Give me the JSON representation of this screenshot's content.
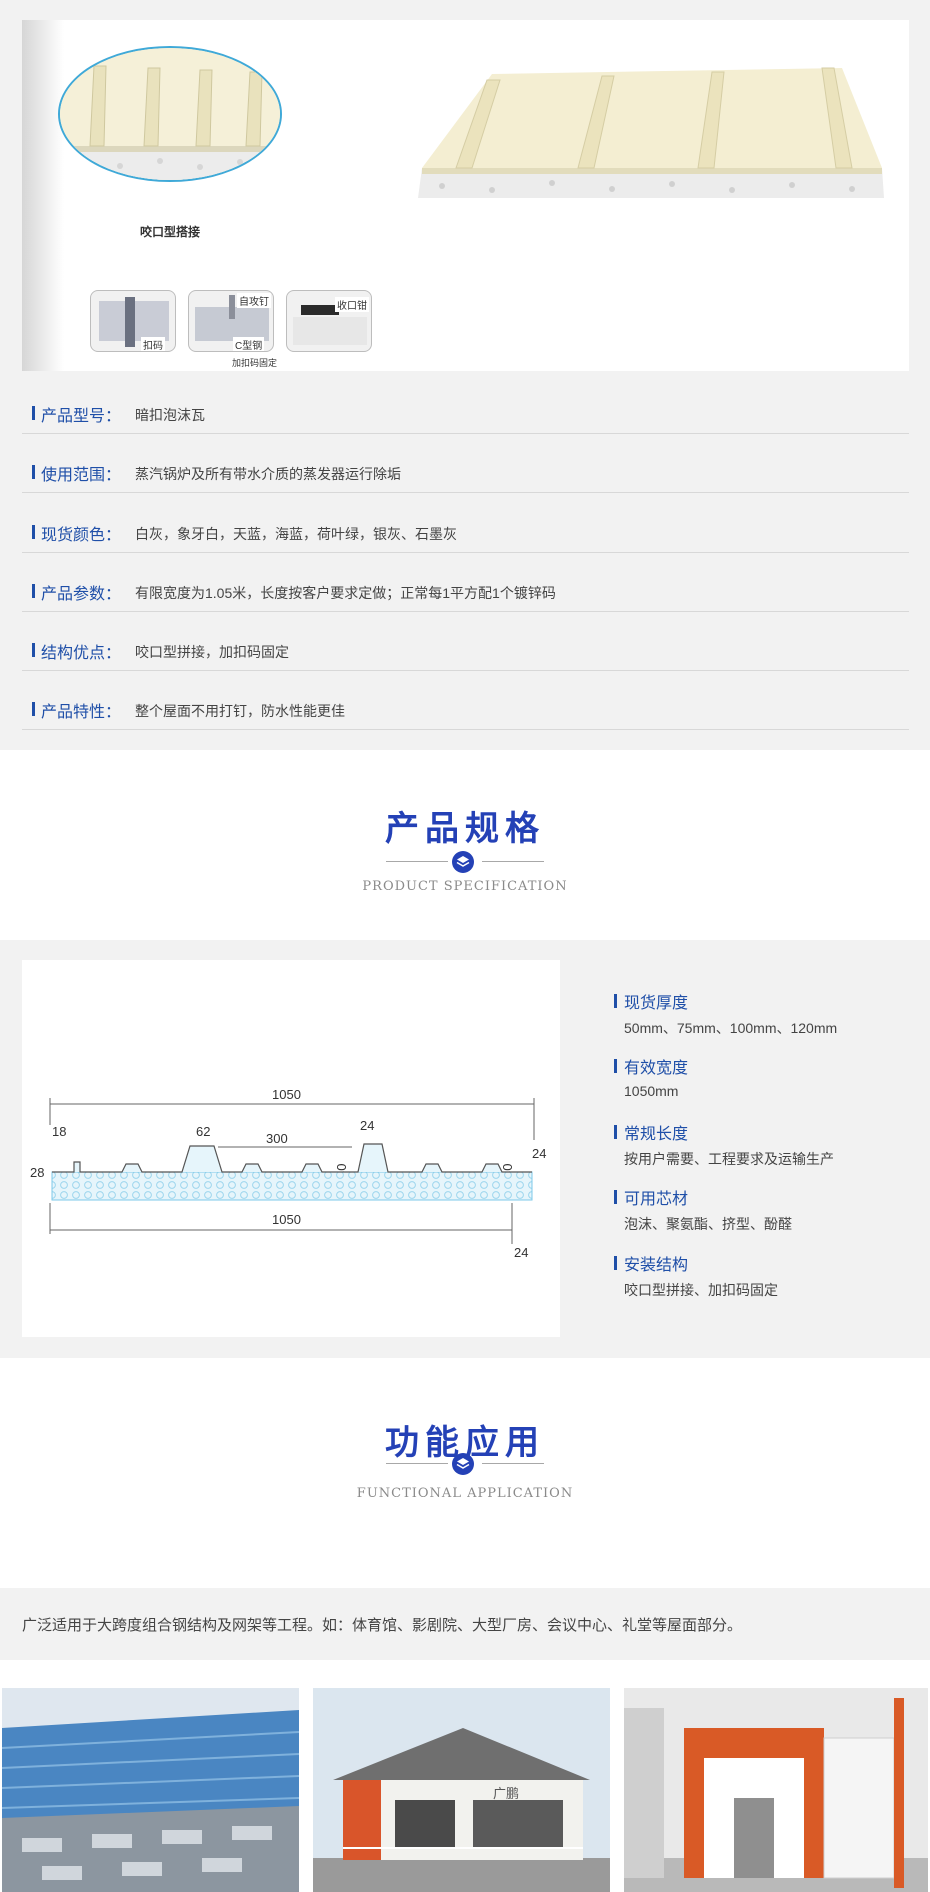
{
  "product": {
    "image": {
      "oval_caption": "咬口型搭接",
      "thumbs": [
        "扣码",
        "自攻钉",
        "C型钢",
        "收口钳"
      ],
      "thumb_sub": "加扣码固定"
    },
    "properties": [
      {
        "label": "产品型号：",
        "value": "暗扣泡沫瓦"
      },
      {
        "label": "使用范围：",
        "value": "蒸汽锅炉及所有带水介质的蒸发器运行除垢"
      },
      {
        "label": "现货颜色：",
        "value": "白灰，象牙白，天蓝，海蓝，荷叶绿，银灰、石墨灰"
      },
      {
        "label": "产品参数：",
        "value": "有限宽度为1.05米，长度按客户要求定做；正常每1平方配1个镀锌码"
      },
      {
        "label": "结构优点：",
        "value": "咬口型拼接，加扣码固定"
      },
      {
        "label": "产品特性：",
        "value": "整个屋面不用打钉，防水性能更佳"
      }
    ]
  },
  "spec_section": {
    "title": "产品规格",
    "subtitle": "PRODUCT SPECIFICATION",
    "diagram": {
      "top_width": "1050",
      "bottom_width": "1050",
      "dims": [
        "18",
        "62",
        "300",
        "24",
        "28",
        "30",
        "30",
        "24",
        "24"
      ]
    },
    "specs": [
      {
        "label": "现货厚度",
        "value": "50mm、75mm、100mm、120mm"
      },
      {
        "label": "有效宽度",
        "value": "1050mm"
      },
      {
        "label": "常规长度",
        "value": "按用户需要、工程要求及运输生产"
      },
      {
        "label": "可用芯材",
        "value": "泡沫、聚氨酯、挤型、酚醛"
      },
      {
        "label": "安装结构",
        "value": "咬口型拼接、加扣码固定"
      }
    ]
  },
  "application_section": {
    "title": "功能应用",
    "subtitle": "FUNCTIONAL APPLICATION",
    "description": "广泛适用于大跨度组合钢结构及网架等工程。如：体育馆、影剧院、大型厂房、会议中心、礼堂等屋面部分。",
    "house_sign": "广鹏"
  },
  "colors": {
    "accent": "#2441b6",
    "label_blue": "#1f4fa8",
    "panel_cream": "#f2ecc6",
    "section_bg": "#f2f2f2"
  }
}
